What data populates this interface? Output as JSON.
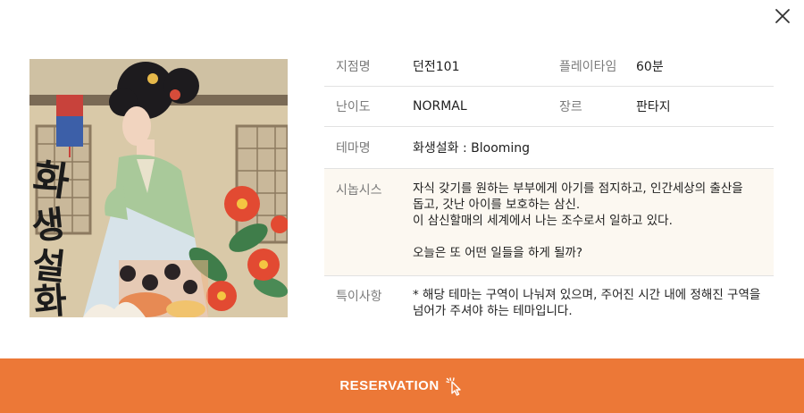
{
  "poster": {
    "title_text": "화생설화"
  },
  "details": {
    "branch_label": "지점명",
    "branch_value": "던전101",
    "playtime_label": "플레이타임",
    "playtime_value": "60분",
    "difficulty_label": "난이도",
    "difficulty_value": "NORMAL",
    "genre_label": "장르",
    "genre_value": "판타지",
    "theme_label": "테마명",
    "theme_value": "화생설화 : Blooming",
    "synopsis_label": "시놉시스",
    "synopsis_lines": [
      "자식 갖기를 원하는 부부에게 아기를 점지하고, 인간세상의 출산을",
      "돕고, 갓난 아이를 보호하는 삼신.",
      "이 삼신할매의 세계에서 나는 조수로서 일하고 있다.",
      "오늘은 또 어떤 일들을 하게 될까?"
    ],
    "notice_label": "특이사항",
    "notice_lines": [
      "* 해당 테마는 구역이 나눠져 있으며, 주어진 시간 내에 정해진 구역을",
      "넘어가 주셔야 하는 테마입니다."
    ]
  },
  "reservation": {
    "label": "RESERVATION",
    "icon": "pointer-click-icon"
  },
  "close": {
    "icon": "close-icon"
  },
  "colors": {
    "accent": "#ec7837",
    "cream_row": "#fcf8f1",
    "divider": "#e2e2e2"
  }
}
